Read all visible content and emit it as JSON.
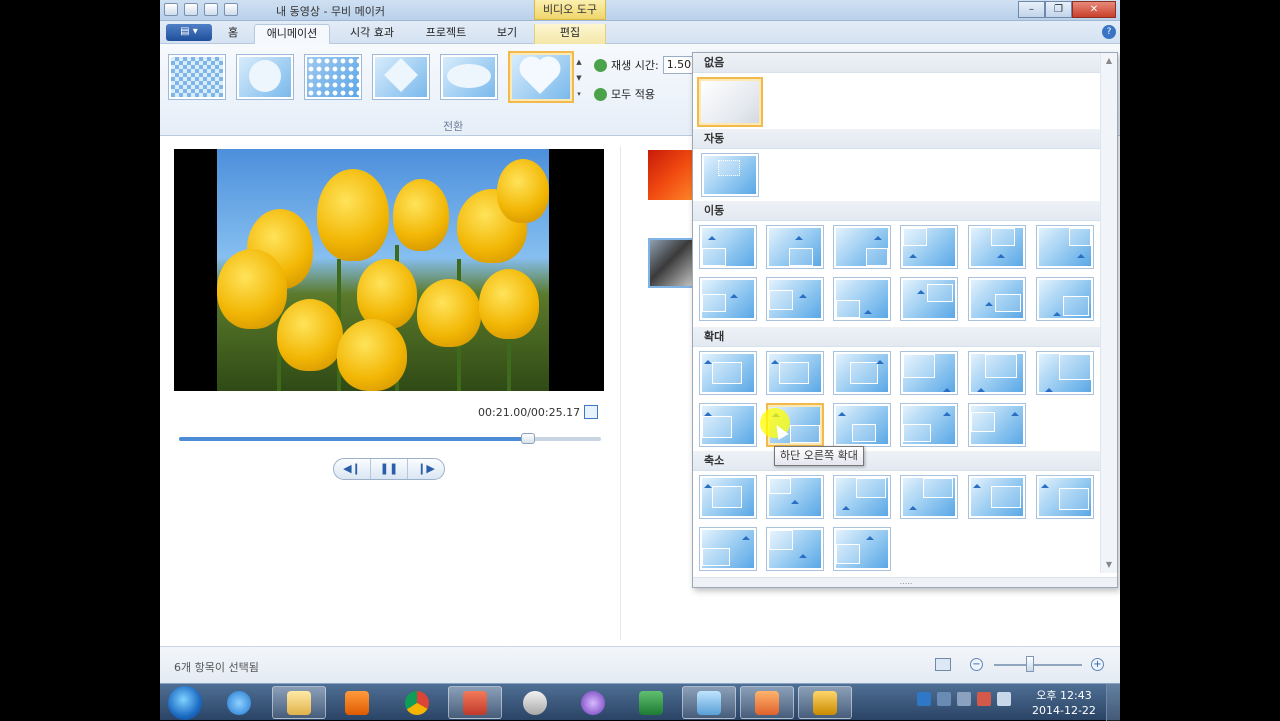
{
  "window": {
    "title": "내 동영상 - 무비 메이커",
    "context_tab_title": "비디오 도구"
  },
  "tabs": [
    {
      "label": "홈"
    },
    {
      "label": "애니메이션"
    },
    {
      "label": "시각 효과"
    },
    {
      "label": "프로젝트"
    },
    {
      "label": "보기"
    },
    {
      "label": "편집"
    }
  ],
  "ribbon": {
    "duration_label": "재생 시간:",
    "duration_value": "1.50",
    "apply_all_label": "모두 적용",
    "group_label": "전환",
    "gallery": [
      "checkerboard",
      "circle",
      "dots",
      "diamond",
      "oval",
      "heart"
    ],
    "selected": "heart"
  },
  "preview": {
    "time": "00:21.00/00:25.17",
    "progress": 0.827
  },
  "dropdown": {
    "sections": [
      {
        "label": "없음"
      },
      {
        "label": "자동"
      },
      {
        "label": "이동"
      },
      {
        "label": "확대"
      },
      {
        "label": "축소"
      }
    ]
  },
  "tooltip": "하단 오른쪽 확대",
  "status": {
    "text": "6개 항목이 선택됨"
  },
  "taskbar": {
    "time": "오후 12:43",
    "date": "2014-12-22"
  },
  "colors": {
    "accent": "#4b8cd4",
    "selection": "#f2b94c",
    "taskbar": "#2b4466"
  }
}
